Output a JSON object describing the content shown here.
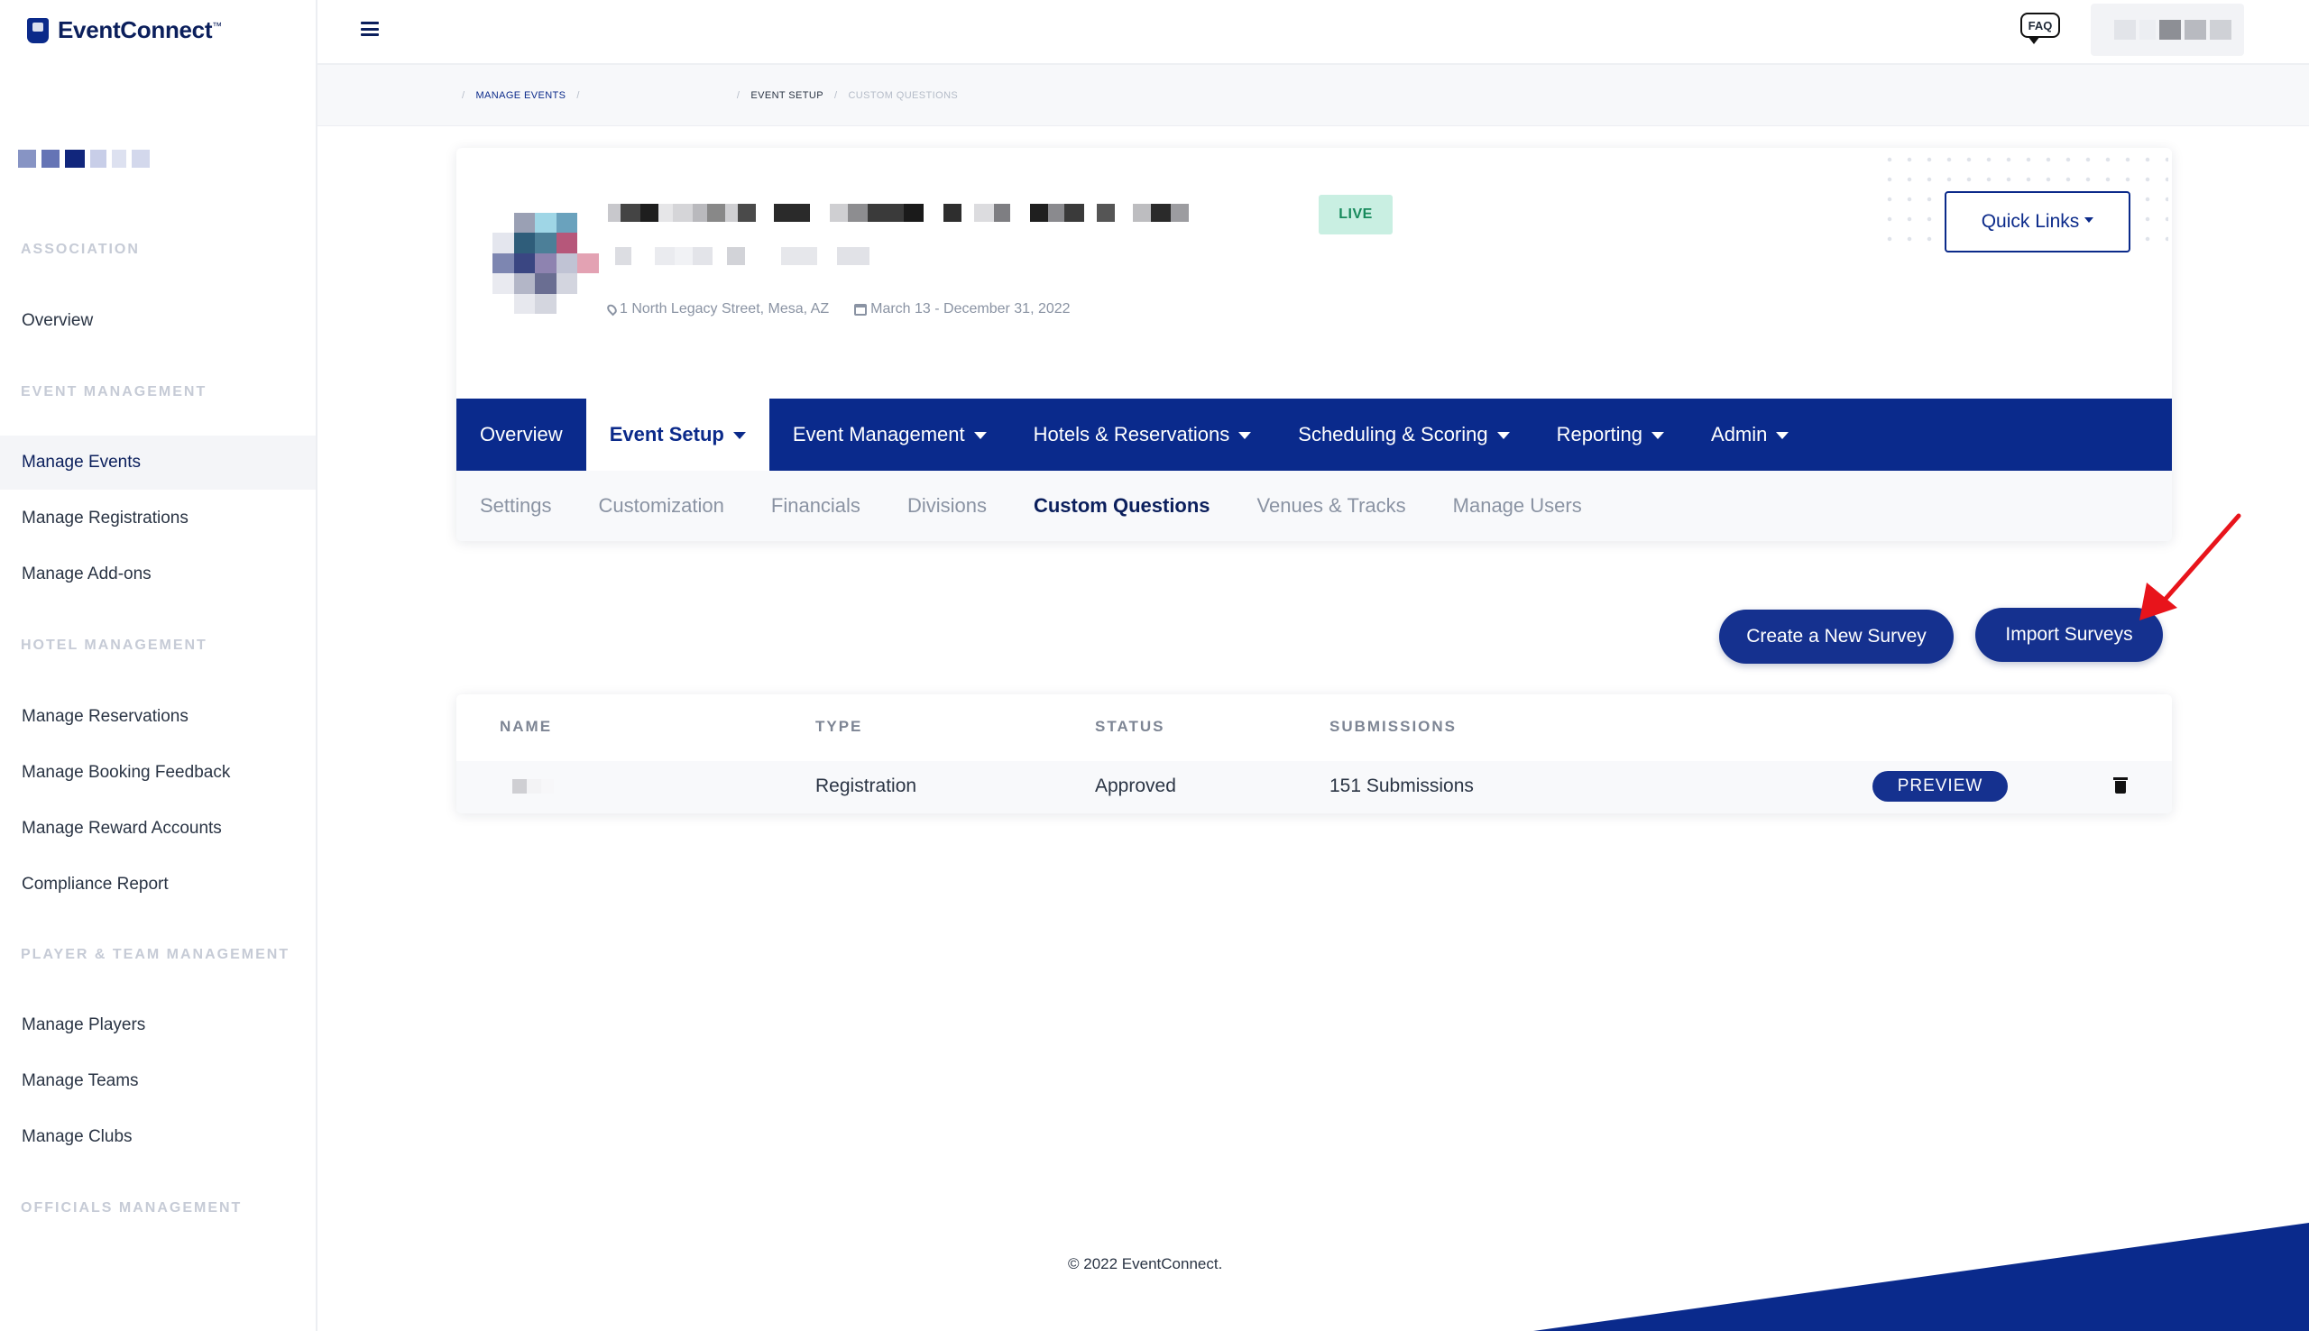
{
  "brand": {
    "name": "EventConnect",
    "tm": "™"
  },
  "sidebar": {
    "sections": [
      {
        "label": "ASSOCIATION"
      },
      {
        "label": "EVENT MANAGEMENT"
      },
      {
        "label": "HOTEL MANAGEMENT"
      },
      {
        "label": "PLAYER & TEAM MANAGEMENT"
      },
      {
        "label": "OFFICIALS MANAGEMENT"
      }
    ],
    "items": [
      {
        "label": "Overview"
      },
      {
        "label": "Manage Events",
        "active": true
      },
      {
        "label": "Manage Registrations"
      },
      {
        "label": "Manage Add-ons"
      },
      {
        "label": "Manage Reservations"
      },
      {
        "label": "Manage Booking Feedback"
      },
      {
        "label": "Manage Reward Accounts"
      },
      {
        "label": "Compliance Report"
      },
      {
        "label": "Manage Players"
      },
      {
        "label": "Manage Teams"
      },
      {
        "label": "Manage Clubs"
      }
    ]
  },
  "topbar": {
    "faq_label": "FAQ"
  },
  "breadcrumb": {
    "items": [
      "MANAGE EVENTS",
      "EVENT SETUP",
      "CUSTOM QUESTIONS"
    ],
    "separator": "/"
  },
  "event": {
    "status_badge": "LIVE",
    "location": "1 North Legacy Street, Mesa, AZ",
    "dates": "March 13 - December 31, 2022",
    "quick_links_label": "Quick Links"
  },
  "main_nav": {
    "tabs": [
      {
        "label": "Overview",
        "caret": false
      },
      {
        "label": "Event Setup",
        "caret": true,
        "active": true
      },
      {
        "label": "Event Management",
        "caret": true
      },
      {
        "label": "Hotels & Reservations",
        "caret": true
      },
      {
        "label": "Scheduling & Scoring",
        "caret": true
      },
      {
        "label": "Reporting",
        "caret": true
      },
      {
        "label": "Admin",
        "caret": true
      }
    ]
  },
  "sub_nav": {
    "tabs": [
      {
        "label": "Settings"
      },
      {
        "label": "Customization"
      },
      {
        "label": "Financials"
      },
      {
        "label": "Divisions"
      },
      {
        "label": "Custom Questions",
        "active": true
      },
      {
        "label": "Venues & Tracks"
      },
      {
        "label": "Manage Users"
      }
    ]
  },
  "actions": {
    "create_label": "Create a New Survey",
    "import_label": "Import Surveys"
  },
  "surveys_table": {
    "columns": [
      "NAME",
      "TYPE",
      "STATUS",
      "SUBMISSIONS"
    ],
    "rows": [
      {
        "type": "Registration",
        "status": "Approved",
        "submissions": "151 Submissions",
        "preview_label": "PREVIEW"
      }
    ]
  },
  "footer": {
    "copyright": "© 2022 EventConnect."
  },
  "colors": {
    "brand_navy": "#0a2a8c",
    "button_navy": "#15318f",
    "live_bg": "#c9efe2",
    "live_text": "#178a5c",
    "annotation_red": "#e8141b"
  },
  "icons": {
    "menu": "hamburger-icon",
    "faq": "faq-bubble-icon",
    "location": "map-pin-icon",
    "date": "calendar-icon",
    "delete": "trash-icon"
  }
}
